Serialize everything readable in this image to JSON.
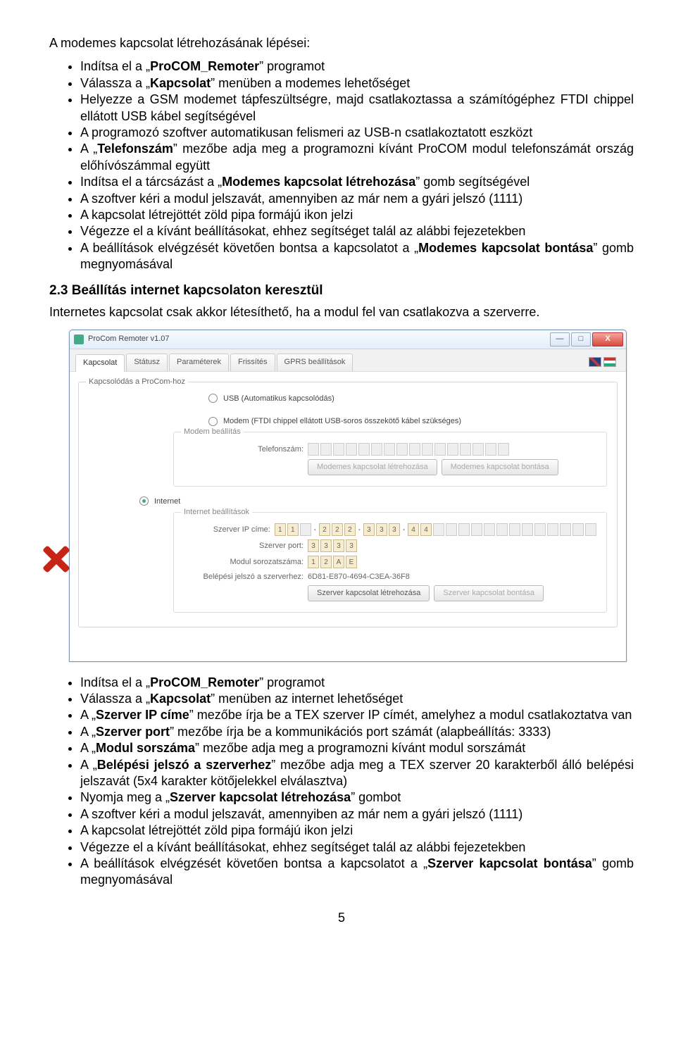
{
  "doc": {
    "intro": "A modemes kapcsolat létrehozásának lépései:",
    "list1": {
      "items": [
        {
          "pre": "Indítsa el a „",
          "b": "ProCOM_Remoter",
          "post": "” programot"
        },
        {
          "pre": "Válassza a „",
          "b": "Kapcsolat",
          "post": "” menüben a modemes lehetőséget"
        },
        {
          "pre": "Helyezze a GSM modemet tápfeszültségre, majd csatlakoztassa a számítógéphez FTDI chippel ellátott USB kábel segítségével",
          "b": "",
          "post": ""
        },
        {
          "pre": "A programozó szoftver automatikusan felismeri az USB-n csatlakoztatott eszközt",
          "b": "",
          "post": ""
        },
        {
          "pre": "A „",
          "b": "Telefonszám",
          "post": "” mezőbe adja meg a programozni kívánt ProCOM modul telefonszámát ország előhívószámmal együtt"
        },
        {
          "pre": "Indítsa el a tárcsázást a „",
          "b": "Modemes kapcsolat létrehozása",
          "post": "” gomb segítségével"
        },
        {
          "pre": "A szoftver kéri a modul jelszavát, amennyiben az már nem a gyári jelszó (1111)",
          "b": "",
          "post": ""
        },
        {
          "pre": "A kapcsolat létrejöttét zöld pipa formájú ikon jelzi",
          "b": "",
          "post": ""
        },
        {
          "pre": "Végezze el a kívánt beállításokat, ehhez segítséget talál az alábbi fejezetekben",
          "b": "",
          "post": ""
        },
        {
          "pre": "A beállítások elvégzését követően bontsa a kapcsolatot a „",
          "b": "Modemes kapcsolat bontása",
          "post": "” gomb megnyomásával"
        }
      ]
    },
    "section_h": "2.3   Beállítás internet kapcsolaton keresztül",
    "section_p": "Internetes kapcsolat csak akkor létesíthető, ha a modul fel van csatlakozva a szerverre.",
    "list2": {
      "items": [
        {
          "pre": "Indítsa el a „",
          "b": "ProCOM_Remoter",
          "post": "” programot"
        },
        {
          "pre": "Válassza a „",
          "b": "Kapcsolat",
          "post": "” menüben az internet lehetőséget"
        },
        {
          "pre": "A „",
          "b": "Szerver IP címe",
          "post": "” mezőbe írja be a TEX szerver IP címét, amelyhez a modul csatlakoztatva van"
        },
        {
          "pre": "A „",
          "b": "Szerver port",
          "post": "” mezőbe írja be a kommunikációs port számát (alapbeállítás: 3333)"
        },
        {
          "pre": "A „",
          "b": "Modul sorszáma",
          "post": "” mezőbe adja meg a programozni kívánt modul sorszámát"
        },
        {
          "pre": "A „",
          "b": "Belépési jelszó a szerverhez",
          "post": "” mezőbe adja meg a TEX szerver 20 karakterből álló belépési jelszavát (5x4 karakter kötőjelekkel elválasztva)"
        },
        {
          "pre": "Nyomja meg a „",
          "b": "Szerver kapcsolat létrehozása",
          "post": "” gombot"
        },
        {
          "pre": "A szoftver kéri a modul jelszavát, amennyiben az már nem a gyári jelszó (1111)",
          "b": "",
          "post": ""
        },
        {
          "pre": "A kapcsolat létrejöttét zöld pipa formájú ikon jelzi",
          "b": "",
          "post": ""
        },
        {
          "pre": "Végezze el a kívánt beállításokat, ehhez segítséget talál az alábbi fejezetekben",
          "b": "",
          "post": ""
        },
        {
          "pre": "A beállítások elvégzését követően bontsa a kapcsolatot a „",
          "b": "Szerver kapcsolat bontása",
          "post": "” gomb megnyomásával"
        }
      ]
    },
    "page_no": "5"
  },
  "win": {
    "title": "ProCom Remoter v1.07",
    "min": "—",
    "max": "□",
    "close": "X",
    "tabs": [
      "Kapcsolat",
      "Státusz",
      "Paraméterek",
      "Frissítés",
      "GPRS beállítások"
    ],
    "group_title": "Kapcsolódás a ProCom-hoz",
    "opt_usb": "USB (Automatikus kapcsolódás)",
    "opt_modem": "Modem (FTDI chippel ellátott USB-soros összekötő kábel szükséges)",
    "modem_box": "Modem beállítás",
    "tel_label": "Telefonszám:",
    "btn_modem_create": "Modemes kapcsolat létrehozása",
    "btn_modem_close": "Modemes kapcsolat bontása",
    "opt_internet": "Internet",
    "inet_box": "Internet beállítások",
    "ip_label": "Szerver IP címe:",
    "ip": {
      "a": [
        "1",
        "1"
      ],
      "b": [
        "2",
        "2",
        "2"
      ],
      "c": [
        "3",
        "3",
        "3"
      ],
      "d": [
        "4",
        "4"
      ]
    },
    "port_label": "Szerver port:",
    "port": [
      "3",
      "3",
      "3",
      "3"
    ],
    "serial_label": "Modul sorozatszáma:",
    "serial": [
      "1",
      "2",
      "A",
      "E"
    ],
    "pass_label": "Belépési jelszó a szerverhez:",
    "pass_value": "6D81-E870-4694-C3EA-36F8",
    "btn_srv_create": "Szerver kapcsolat létrehozása",
    "btn_srv_close": "Szerver kapcsolat bontása"
  }
}
